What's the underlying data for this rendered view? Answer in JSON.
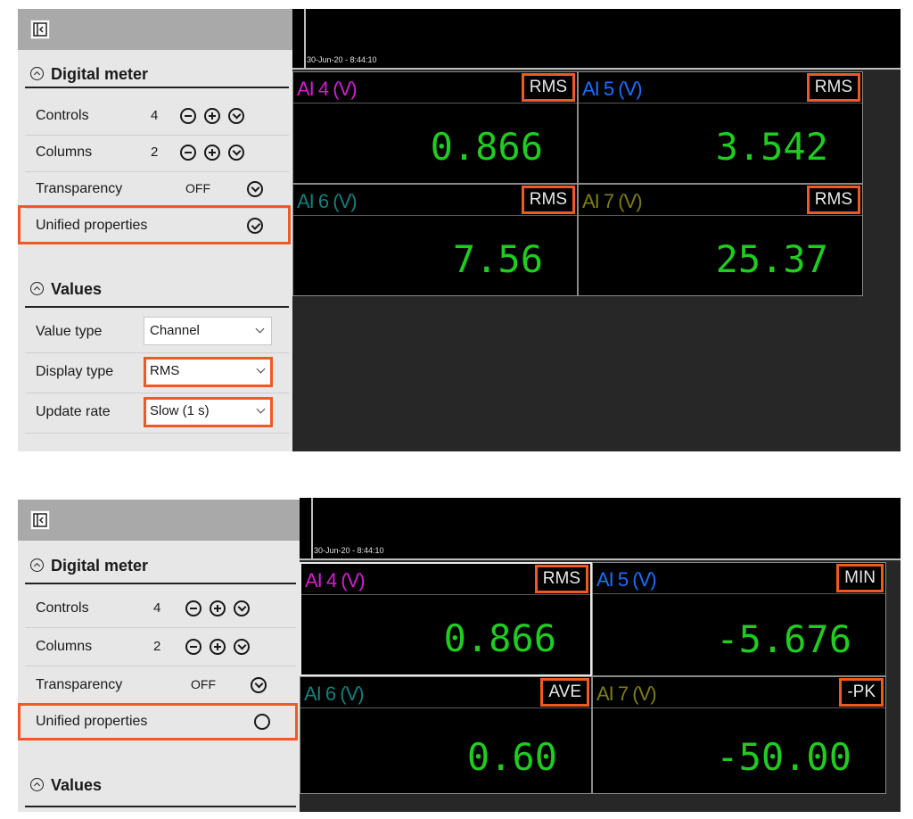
{
  "colors": {
    "accent_highlight": "#f05a22",
    "value_green": "#1fcc1f",
    "ch_magenta": "#d21fd0",
    "ch_blue": "#1a6fff",
    "ch_teal": "#157f7d",
    "ch_olive": "#7e7d16"
  },
  "top": {
    "sidebar": {
      "toggle_icon": "panel-collapse-icon",
      "digital_meter_title": "Digital meter",
      "controls_label": "Controls",
      "controls_value": "4",
      "columns_label": "Columns",
      "columns_value": "2",
      "transparency_label": "Transparency",
      "transparency_value": "OFF",
      "unified_label": "Unified properties",
      "unified_checked": true,
      "values_title": "Values",
      "value_type_label": "Value type",
      "value_type_value": "Channel",
      "display_type_label": "Display type",
      "display_type_value": "RMS",
      "update_rate_label": "Update rate",
      "update_rate_value": "Slow (1 s)"
    },
    "timestamp": "30-Jun-20 - 8:44:10",
    "meters": [
      {
        "name": "AI 4 (V)",
        "tag": "RMS",
        "value": "0.866",
        "color": "#d21fd0"
      },
      {
        "name": "AI 5 (V)",
        "tag": "RMS",
        "value": "3.542",
        "color": "#1a6fff"
      },
      {
        "name": "AI 6 (V)",
        "tag": "RMS",
        "value": "7.56",
        "color": "#157f7d"
      },
      {
        "name": "AI 7 (V)",
        "tag": "RMS",
        "value": "25.37",
        "color": "#7e7d16"
      }
    ]
  },
  "bottom": {
    "sidebar": {
      "toggle_icon": "panel-collapse-icon",
      "digital_meter_title": "Digital meter",
      "controls_label": "Controls",
      "controls_value": "4",
      "columns_label": "Columns",
      "columns_value": "2",
      "transparency_label": "Transparency",
      "transparency_value": "OFF",
      "unified_label": "Unified properties",
      "unified_checked": false,
      "values_title": "Values"
    },
    "timestamp": "30-Jun-20 - 8:44:10",
    "meters": [
      {
        "name": "AI 4 (V)",
        "tag": "RMS",
        "value": "0.866",
        "color": "#d21fd0"
      },
      {
        "name": "AI 5 (V)",
        "tag": "MIN",
        "value": "-5.676",
        "color": "#1a6fff"
      },
      {
        "name": "AI 6 (V)",
        "tag": "AVE",
        "value": "0.60",
        "color": "#157f7d"
      },
      {
        "name": "AI 7 (V)",
        "tag": "-PK",
        "value": "-50.00",
        "color": "#7e7d16"
      }
    ]
  }
}
